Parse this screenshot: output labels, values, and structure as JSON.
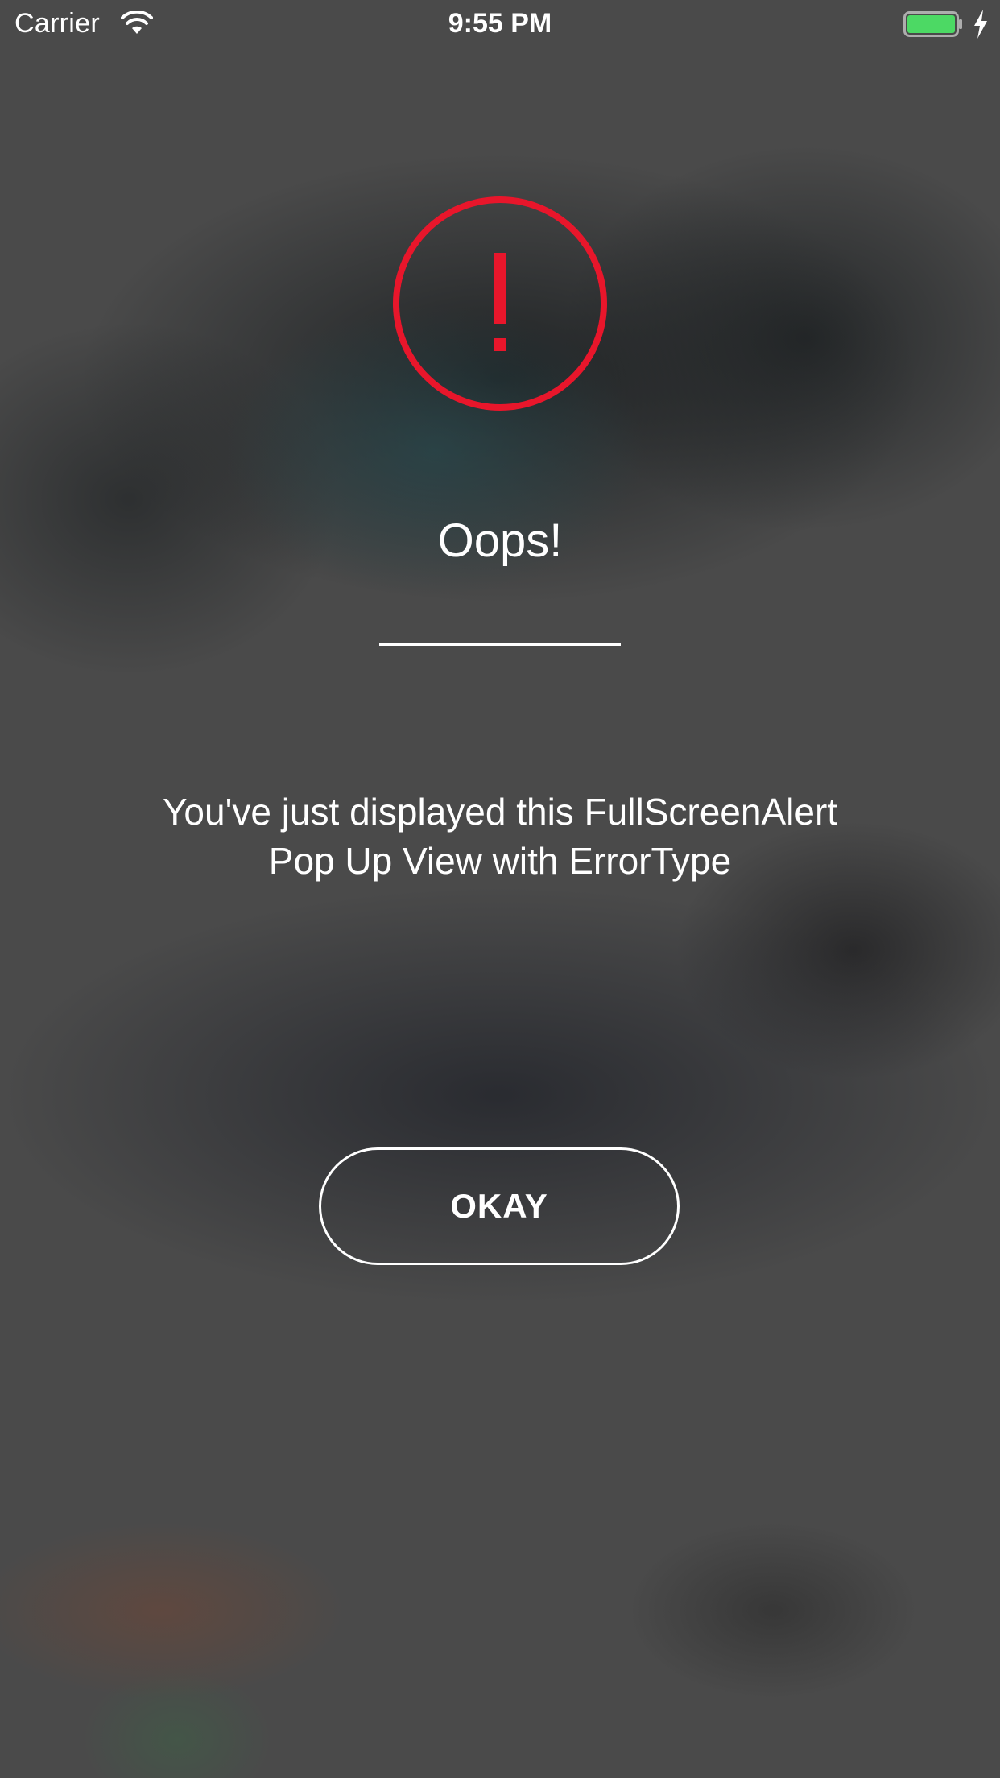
{
  "status_bar": {
    "carrier": "Carrier",
    "time": "9:55 PM",
    "wifi_icon": "wifi-icon",
    "battery_icon": "battery-icon",
    "charging_icon": "charging-bolt-icon",
    "battery_level": 1.0
  },
  "alert": {
    "icon": "exclamation-circle-icon",
    "icon_color": "#e8162b",
    "title": "Oops!",
    "message": "You've just displayed this FullScreenAlert Pop Up View with ErrorType",
    "button_label": "OKAY"
  },
  "colors": {
    "battery_fill": "#4cd964",
    "text": "#ffffff"
  }
}
